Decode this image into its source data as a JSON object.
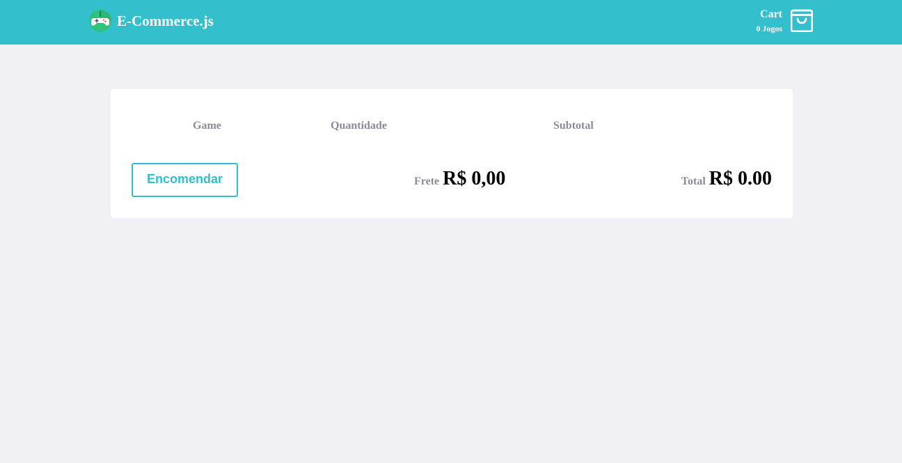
{
  "header": {
    "brand": "E-Commerce.js",
    "logo_icon": "gamepad-icon",
    "cart_label": "Cart",
    "cart_count": "0 Jogos",
    "cart_icon": "shopping-bag-icon",
    "background_color": "#33bfcb"
  },
  "cart_table": {
    "columns": [
      "Game",
      "Quantidade",
      "Subtotal"
    ],
    "order_button_label": "Encomendar",
    "shipping_label": "Frete",
    "shipping_value": "R$ 0,00",
    "total_label": "Total",
    "total_value": "R$ 0.00"
  },
  "colors": {
    "accent": "#33bfcb",
    "page_background": "#f0f0f5",
    "muted_text": "#8a8a9a"
  }
}
